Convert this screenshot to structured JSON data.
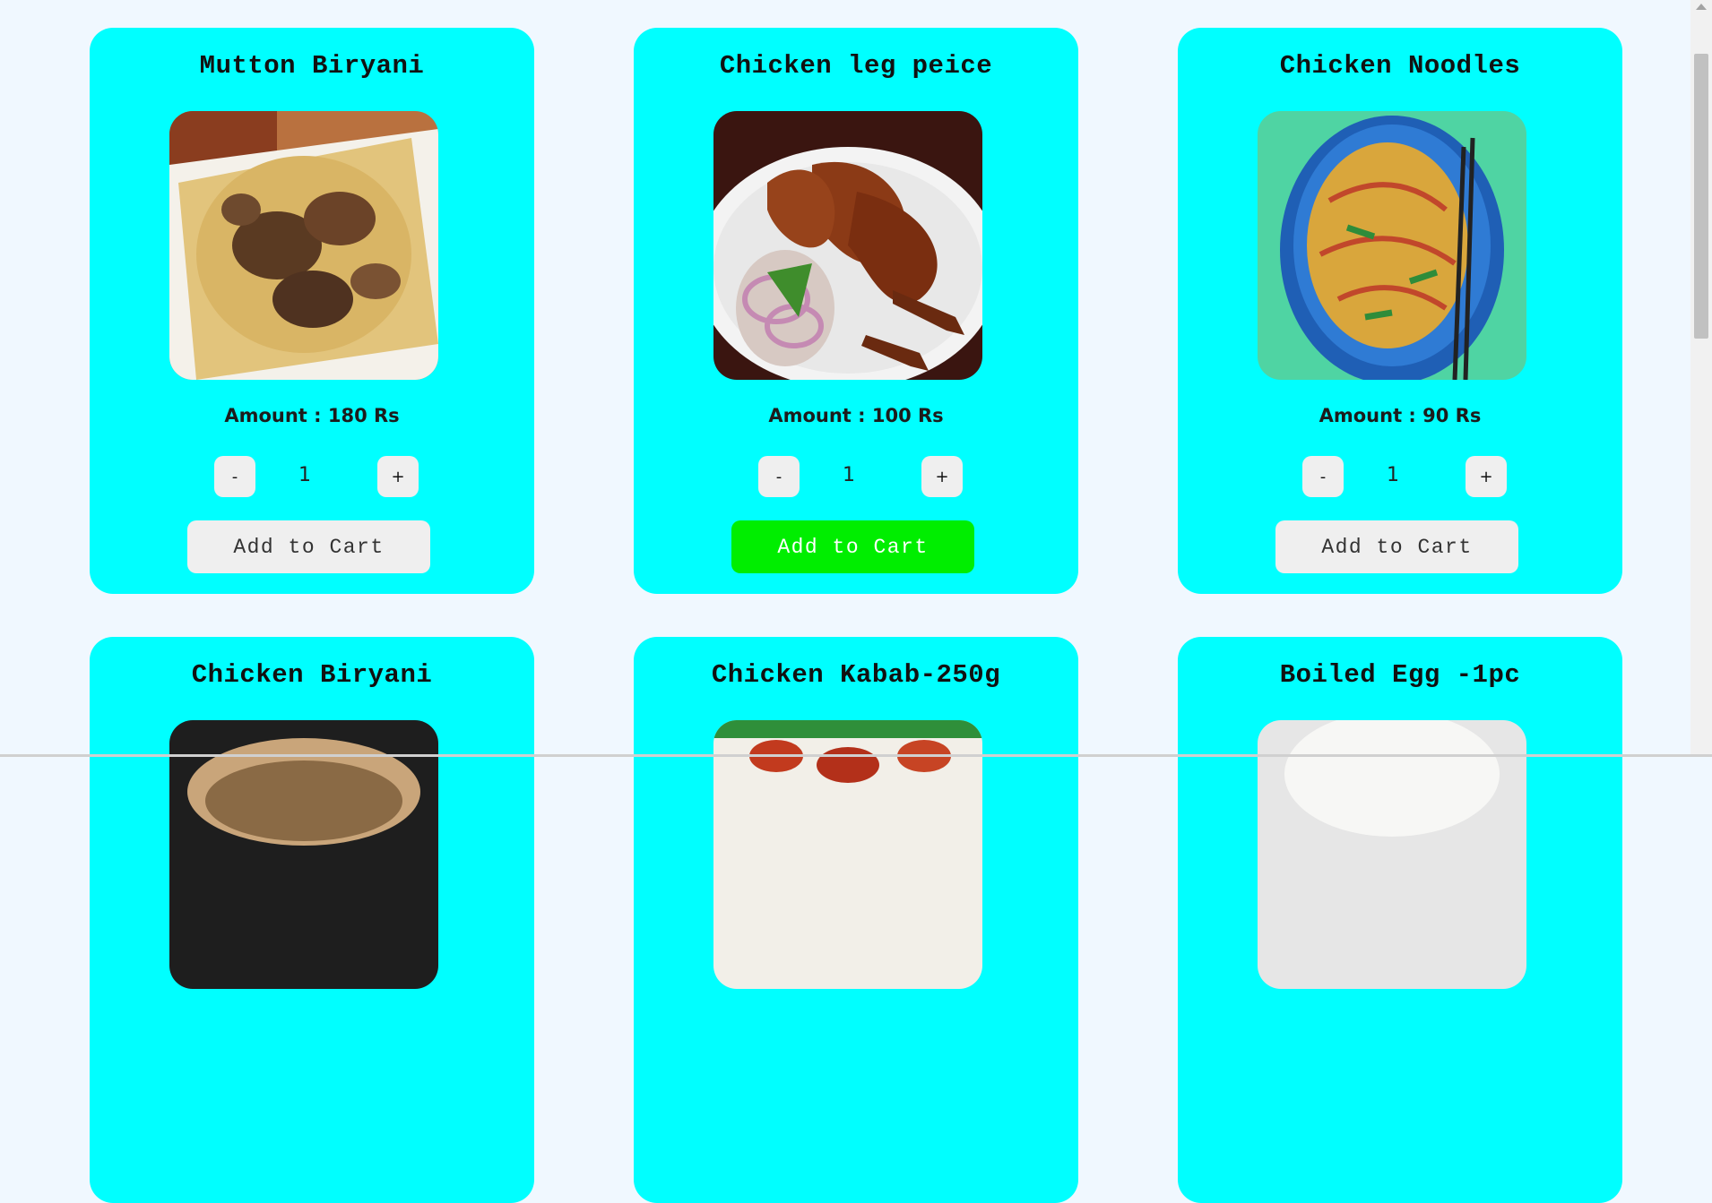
{
  "products": [
    {
      "name": "Mutton Biryani",
      "amount": "Amount : 180 Rs",
      "qty": "1",
      "minus": "-",
      "plus": "+",
      "cart": "Add to Cart",
      "image": "mutton-biryani-image",
      "cart_active": false
    },
    {
      "name": "Chicken leg peice",
      "amount": "Amount : 100 Rs",
      "qty": "1",
      "minus": "-",
      "plus": "+",
      "cart": "Add to Cart",
      "image": "chicken-leg-image",
      "cart_active": true
    },
    {
      "name": "Chicken Noodles",
      "amount": "Amount : 90 Rs",
      "qty": "1",
      "minus": "-",
      "plus": "+",
      "cart": "Add to Cart",
      "image": "chicken-noodles-image",
      "cart_active": false
    },
    {
      "name": "Chicken Biryani",
      "image": "chicken-biryani-image"
    },
    {
      "name": "Chicken Kabab-250g",
      "image": "chicken-kabab-image"
    },
    {
      "name": "Boiled Egg -1pc",
      "image": "boiled-egg-image"
    }
  ],
  "colors": {
    "page_background": "#f0f8ff",
    "card_background": "#00ffff",
    "button_gray": "#efefef",
    "cart_active": "#00ee00"
  }
}
